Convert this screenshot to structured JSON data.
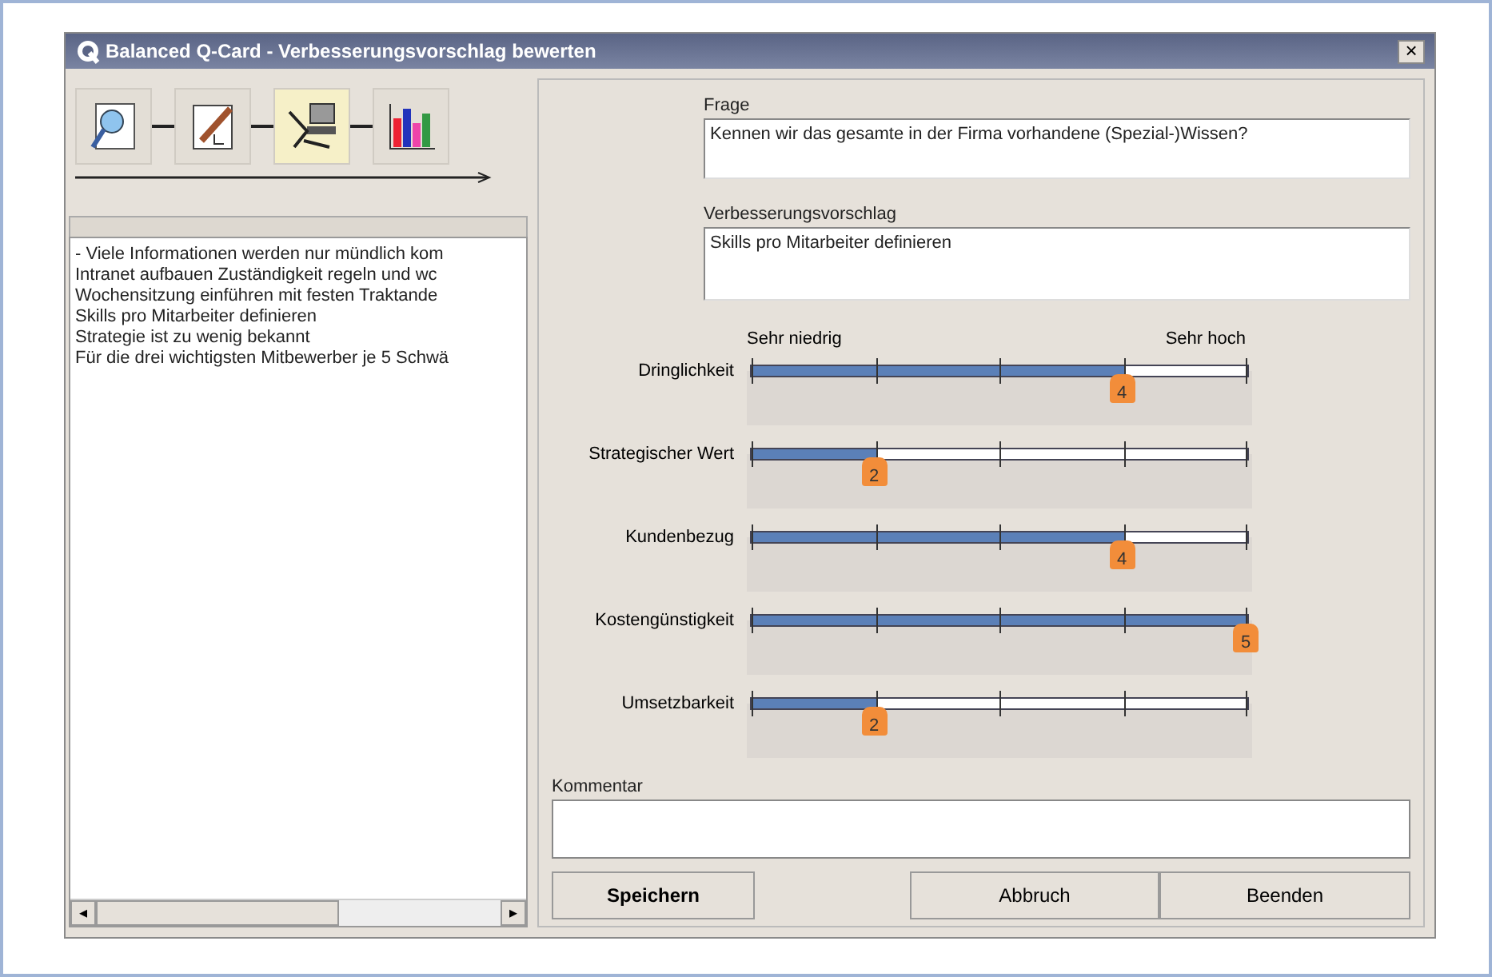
{
  "window": {
    "title": "Balanced Q-Card - Verbesserungsvorschlag bewerten",
    "close": "×"
  },
  "toolbar": {
    "steps": [
      {
        "kind": "search",
        "selected": false
      },
      {
        "kind": "edit",
        "selected": false
      },
      {
        "kind": "computer",
        "selected": true
      },
      {
        "kind": "chart",
        "selected": false
      }
    ]
  },
  "list": {
    "items": [
      "- Viele Informationen werden nur mündlich kom",
      "Intranet aufbauen  Zuständigkeit regeln und wc",
      "Wochensitzung einführen mit festen Traktande",
      "Skills pro Mitarbeiter definieren",
      "Strategie ist zu wenig bekannt",
      "Für die drei wichtigsten Mitbewerber je 5 Schwä"
    ],
    "scroll_left": "◂",
    "scroll_right": "▸"
  },
  "question": {
    "label": "Frage",
    "value": "Kennen wir das gesamte in der Firma vorhandene (Spezial-)Wissen?"
  },
  "suggestion": {
    "label": "Verbesserungsvorschlag",
    "value": "Skills pro Mitarbeiter definieren"
  },
  "scale": {
    "low": "Sehr niedrig",
    "high": "Sehr hoch"
  },
  "ratings": [
    {
      "label": "Dringlichkeit",
      "level": 0.75,
      "value": "4"
    },
    {
      "label": "Strategischer Wert",
      "level": 0.25,
      "value": "2"
    },
    {
      "label": "Kundenbezug",
      "level": 0.75,
      "value": "4"
    },
    {
      "label": "Kostengünstigkeit",
      "level": 1,
      "value": "5"
    },
    {
      "label": "Umsetzbarkeit",
      "level": 0.25,
      "value": "2"
    }
  ],
  "comment": {
    "label": "Kommentar"
  },
  "buttons": {
    "save": "Speichern",
    "cancel": "Abbruch",
    "finish": "Beenden"
  }
}
